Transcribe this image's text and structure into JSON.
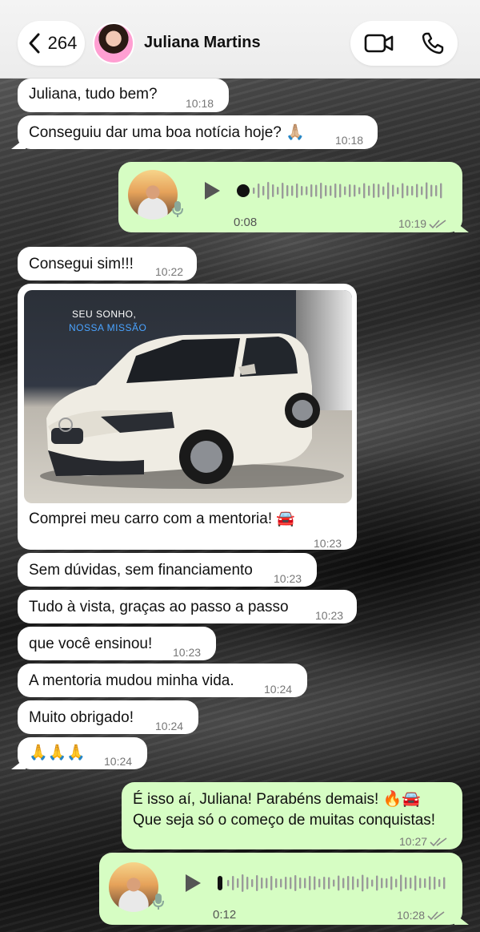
{
  "header": {
    "back_count": "264",
    "contact_name": "Juliana Martins"
  },
  "messages": [
    {
      "text": "Juliana, tudo bem?",
      "time": "10:18"
    },
    {
      "text": "Conseguiu dar uma boa notícia hoje? 🙏🏼",
      "time": "10:18"
    },
    {
      "duration": "0:08",
      "time": "10:19"
    },
    {
      "text": "Consegui sim!!!",
      "time": "10:22"
    },
    {
      "slogan_line1": "SEU SONHO,",
      "slogan_line2": "NOSSA MISSÃO",
      "caption": "Comprei meu carro com a mentoria! 🚘",
      "time": "10:23"
    },
    {
      "text": "Sem dúvidas, sem financiamento",
      "time": "10:23"
    },
    {
      "text": "Tudo à vista, graças ao passo a passo",
      "time": "10:23"
    },
    {
      "text": "que você ensinou!",
      "time": "10:23"
    },
    {
      "text": "A mentoria mudou minha vida.",
      "time": "10:24"
    },
    {
      "text": "Muito obrigado!",
      "time": "10:24"
    },
    {
      "text": "🙏🙏🙏",
      "time": "10:24"
    },
    {
      "line1": "É isso aí, Juliana! Parabéns demais! 🔥🚘",
      "line2": "Que seja só o começo de muitas conquistas!",
      "time": "10:27"
    },
    {
      "duration": "0:12",
      "time": "10:28"
    }
  ],
  "colors": {
    "incoming_bubble": "#ffffff",
    "outgoing_bubble": "#d6fdc3",
    "read_ticks": "#8a8a8a"
  }
}
